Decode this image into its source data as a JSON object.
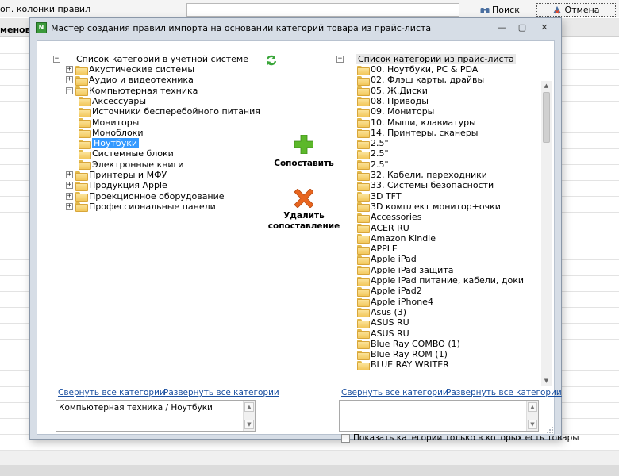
{
  "background": {
    "extra_columns_label": "оп. колонки правил",
    "search_label": "Поиск",
    "cancel_label": "Отмена",
    "column_header": "менова"
  },
  "dialog": {
    "title": "Мастер создания правил импорта на основании категорий товара из прайс-листа",
    "minimize": "—",
    "maximize": "▢",
    "close": "✕"
  },
  "left_tree": {
    "root": "Список категорий в учётной системе",
    "items": [
      {
        "label": "Акустические системы",
        "level": 1,
        "expander": "+"
      },
      {
        "label": "Аудио и видеотехника",
        "level": 1,
        "expander": "+"
      },
      {
        "label": "Компьютерная техника",
        "level": 1,
        "expander": "−"
      },
      {
        "label": "Аксессуары",
        "level": 2,
        "expander": ""
      },
      {
        "label": "Источники бесперебойного питания",
        "level": 2,
        "expander": ""
      },
      {
        "label": "Мониторы",
        "level": 2,
        "expander": ""
      },
      {
        "label": "Моноблоки",
        "level": 2,
        "expander": ""
      },
      {
        "label": "Ноутбуки",
        "level": 2,
        "expander": "",
        "selected": true
      },
      {
        "label": "Системные блоки",
        "level": 2,
        "expander": ""
      },
      {
        "label": "Электронные книги",
        "level": 2,
        "expander": ""
      },
      {
        "label": "Принтеры и МФУ",
        "level": 1,
        "expander": "+"
      },
      {
        "label": "Продукция Apple",
        "level": 1,
        "expander": "+"
      },
      {
        "label": "Проекционное оборудование",
        "level": 1,
        "expander": "+"
      },
      {
        "label": "Профессиональные панели",
        "level": 1,
        "expander": "+"
      }
    ],
    "collapse_all": "Свернуть все категории",
    "expand_all": "Развернуть все категории",
    "path_text": "Компьютерная техника / Ноутбуки"
  },
  "actions": {
    "match_label_1": "Сопоставить",
    "delete_label_1": "Удалить",
    "delete_label_2": "сопоставление",
    "plus_color": "#5cb82a",
    "cross_color": "#e8651f",
    "refresh_color": "#3aa63a"
  },
  "right_tree": {
    "root": "Список категорий из прайс-листа",
    "items": [
      "00. Ноутбуки, PC & PDA",
      "02. Флэш карты, драйвы",
      "05. Ж.Диски",
      "08. Приводы",
      "09. Мониторы",
      "10. Мыши, клавиатуры",
      "14. Принтеры, сканеры",
      "2.5\"",
      "2.5\"",
      "2.5\"",
      "32. Кабели, переходники",
      "33. Системы безопасности",
      "3D TFT",
      "3D комплект монитор+очки",
      "Accessories",
      "ACER RU",
      "Amazon Kindle",
      "APPLE",
      "Apple iPad",
      "Apple iPad защита",
      "Apple iPad питание, кабели, доки",
      "Apple iPad2",
      "Apple iPhone4",
      "Asus (3)",
      "ASUS RU",
      "ASUS RU",
      "Blue Ray COMBO (1)",
      "Blue Ray ROM (1)",
      "BLUE RAY WRITER"
    ],
    "collapse_all": "Свернуть все категории",
    "expand_all": "Развернуть все категории",
    "path_text": "",
    "show_only_with_goods": "Показать категории только в которых есть товары",
    "show_only_checked": false
  }
}
